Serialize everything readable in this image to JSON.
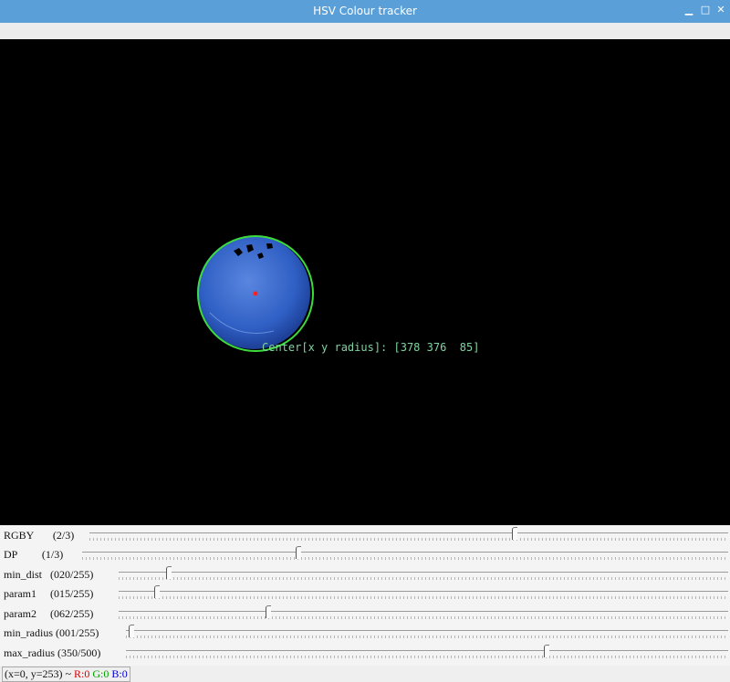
{
  "window": {
    "title": "HSV Colour tracker",
    "minimize": "▁",
    "maximize": "□",
    "close": "✕"
  },
  "overlay": {
    "readout": "Center[x y radius]: [378 376  85]"
  },
  "colors": {
    "titlebar": "#5a9fd8",
    "circle": "#3ddc3d",
    "center_dot": "#ff2020",
    "ball": "#2f5fc4"
  },
  "trackbars": [
    {
      "label": "RGBY       (2/3)",
      "value": 2,
      "max": 3
    },
    {
      "label": "DP         (1/3)",
      "value": 1,
      "max": 3
    },
    {
      "label": "min_dist   (020/255)",
      "value": 20,
      "max": 255
    },
    {
      "label": "param1     (015/255)",
      "value": 15,
      "max": 255
    },
    {
      "label": "param2     (062/255)",
      "value": 62,
      "max": 255
    },
    {
      "label": "min_radius (001/255)",
      "value": 1,
      "max": 255
    },
    {
      "label": "max_radius (350/500)",
      "value": 350,
      "max": 500
    }
  ],
  "status": {
    "position": "(x=0, y=253) ~ ",
    "r": "R:0",
    "g": "G:0",
    "b": "B:0"
  }
}
